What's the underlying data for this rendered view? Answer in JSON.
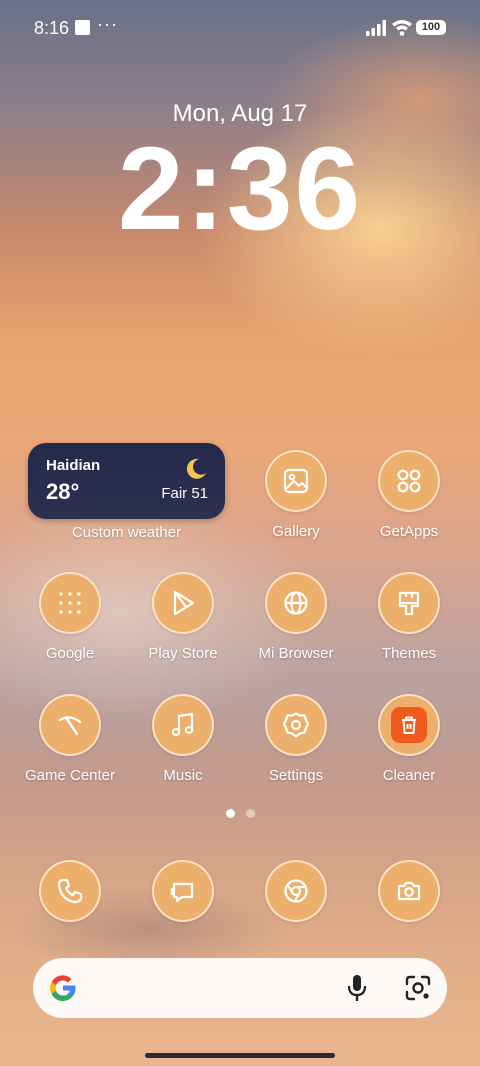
{
  "status_bar": {
    "time": "8:16",
    "dots": "···",
    "battery": "100"
  },
  "lock": {
    "date": "Mon, Aug 17",
    "time": "2:36"
  },
  "weather": {
    "city": "Haidian",
    "temperature": "28°",
    "condition": "Fair 51",
    "label": "Custom weather"
  },
  "apps": {
    "gallery": "Gallery",
    "getapps": "GetApps",
    "google": "Google",
    "play_store": "Play Store",
    "mi_browser": "Mi Browser",
    "themes": "Themes",
    "game_center": "Game Center",
    "music": "Music",
    "settings": "Settings",
    "cleaner": "Cleaner"
  },
  "dock": [
    "phone-icon",
    "messages-icon",
    "chrome-icon",
    "camera-icon"
  ],
  "colors": {
    "icon_bg": "#edb06c",
    "widget_bg": "#24284a",
    "cleaner": "#f05a1c"
  }
}
